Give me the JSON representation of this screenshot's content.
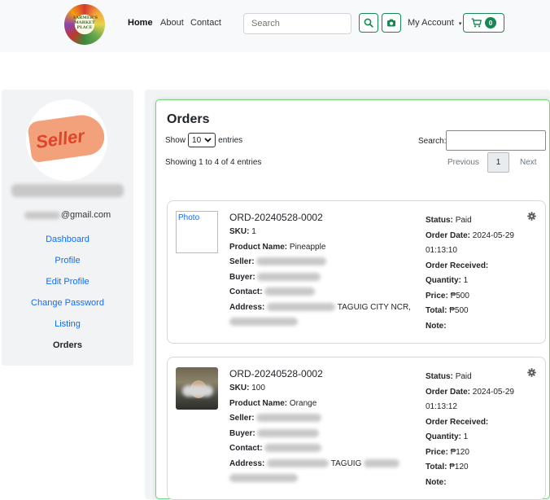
{
  "header": {
    "logo_text": "FARMER'S MARKET PLACE",
    "nav": [
      "Home",
      "About",
      "Contact"
    ],
    "search_placeholder": "Search",
    "search_icon": "search-icon",
    "camera_icon": "camera-icon",
    "account_label": "My Account",
    "cart_icon": "cart-icon",
    "cart_count": "0",
    "accent_color": "#198754"
  },
  "sidebar": {
    "avatar_text": "Seller",
    "email_suffix": "@gmail.com",
    "links": [
      "Dashboard",
      "Profile",
      "Edit Profile",
      "Change Password",
      "Listing",
      "Orders"
    ],
    "active_link": "Orders"
  },
  "orders": {
    "title": "Orders",
    "show_label": "Show",
    "entries_value": "10",
    "entries_label": "entries",
    "search_label": "Search:",
    "info": "Showing 1 to 4 of 4 entries",
    "prev": "Previous",
    "page": "1",
    "next": "Next",
    "items": [
      {
        "photo_alt": "Photo",
        "order_id": "ORD-20240528-0002",
        "sku_label": "SKU:",
        "sku": "1",
        "product_label": "Product Name:",
        "product": "Pineapple",
        "seller_label": "Seller:",
        "buyer_label": "Buyer:",
        "contact_label": "Contact:",
        "address_label": "Address:",
        "address_visible": "TAGUIG CITY NCR,",
        "status_label": "Status:",
        "status": "Paid",
        "date_label": "Order Date:",
        "date": "2024-05-29",
        "time": "01:13:10",
        "received_label": "Order Received:",
        "qty_label": "Quantity:",
        "qty": "1",
        "price_label": "Price:",
        "price": "₱500",
        "total_label": "Total:",
        "total": "₱500",
        "note_label": "Note:"
      },
      {
        "photo_alt": "",
        "order_id": "ORD-20240528-0002",
        "sku_label": "SKU:",
        "sku": "100",
        "product_label": "Product Name:",
        "product": "Orange",
        "seller_label": "Seller:",
        "buyer_label": "Buyer:",
        "contact_label": "Contact:",
        "address_label": "Address:",
        "address_visible": "TAGUIG",
        "status_label": "Status:",
        "status": "Paid",
        "date_label": "Order Date:",
        "date": "2024-05-29",
        "time": "01:13:12",
        "received_label": "Order Received:",
        "qty_label": "Quantity:",
        "qty": "1",
        "price_label": "Price:",
        "price": "₱120",
        "total_label": "Total:",
        "total": "₱120",
        "note_label": "Note:"
      }
    ]
  }
}
